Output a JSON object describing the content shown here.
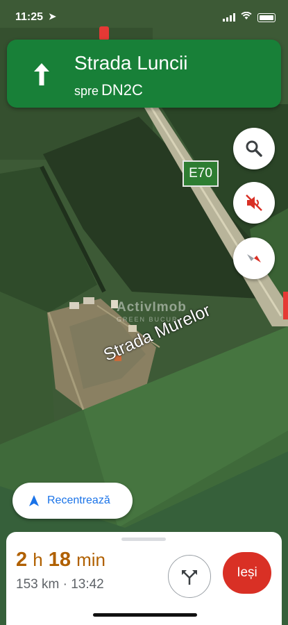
{
  "status": {
    "time": "11:25"
  },
  "banner": {
    "street": "Strada Luncii",
    "toward_prefix": "spre",
    "toward_road": "DN2C",
    "color": "#188038"
  },
  "map": {
    "road_shield": "E70",
    "street_label": "Strada Murelor",
    "watermark": "ActivImob",
    "watermark_sub": "GREEN BUCUR"
  },
  "buttons": {
    "search_icon": "search-icon",
    "mute_icon": "volume-off-icon",
    "compass_icon": "compass-icon",
    "recenter_label": "Recentrează",
    "alternate_icon": "alternate-routes-icon",
    "exit_label": "Ieși"
  },
  "trip": {
    "hours": "2",
    "h_unit": "h",
    "minutes": "18",
    "min_unit": "min",
    "distance": "153 km",
    "separator": "·",
    "arrival": "13:42",
    "eta_color": "#b06000"
  }
}
